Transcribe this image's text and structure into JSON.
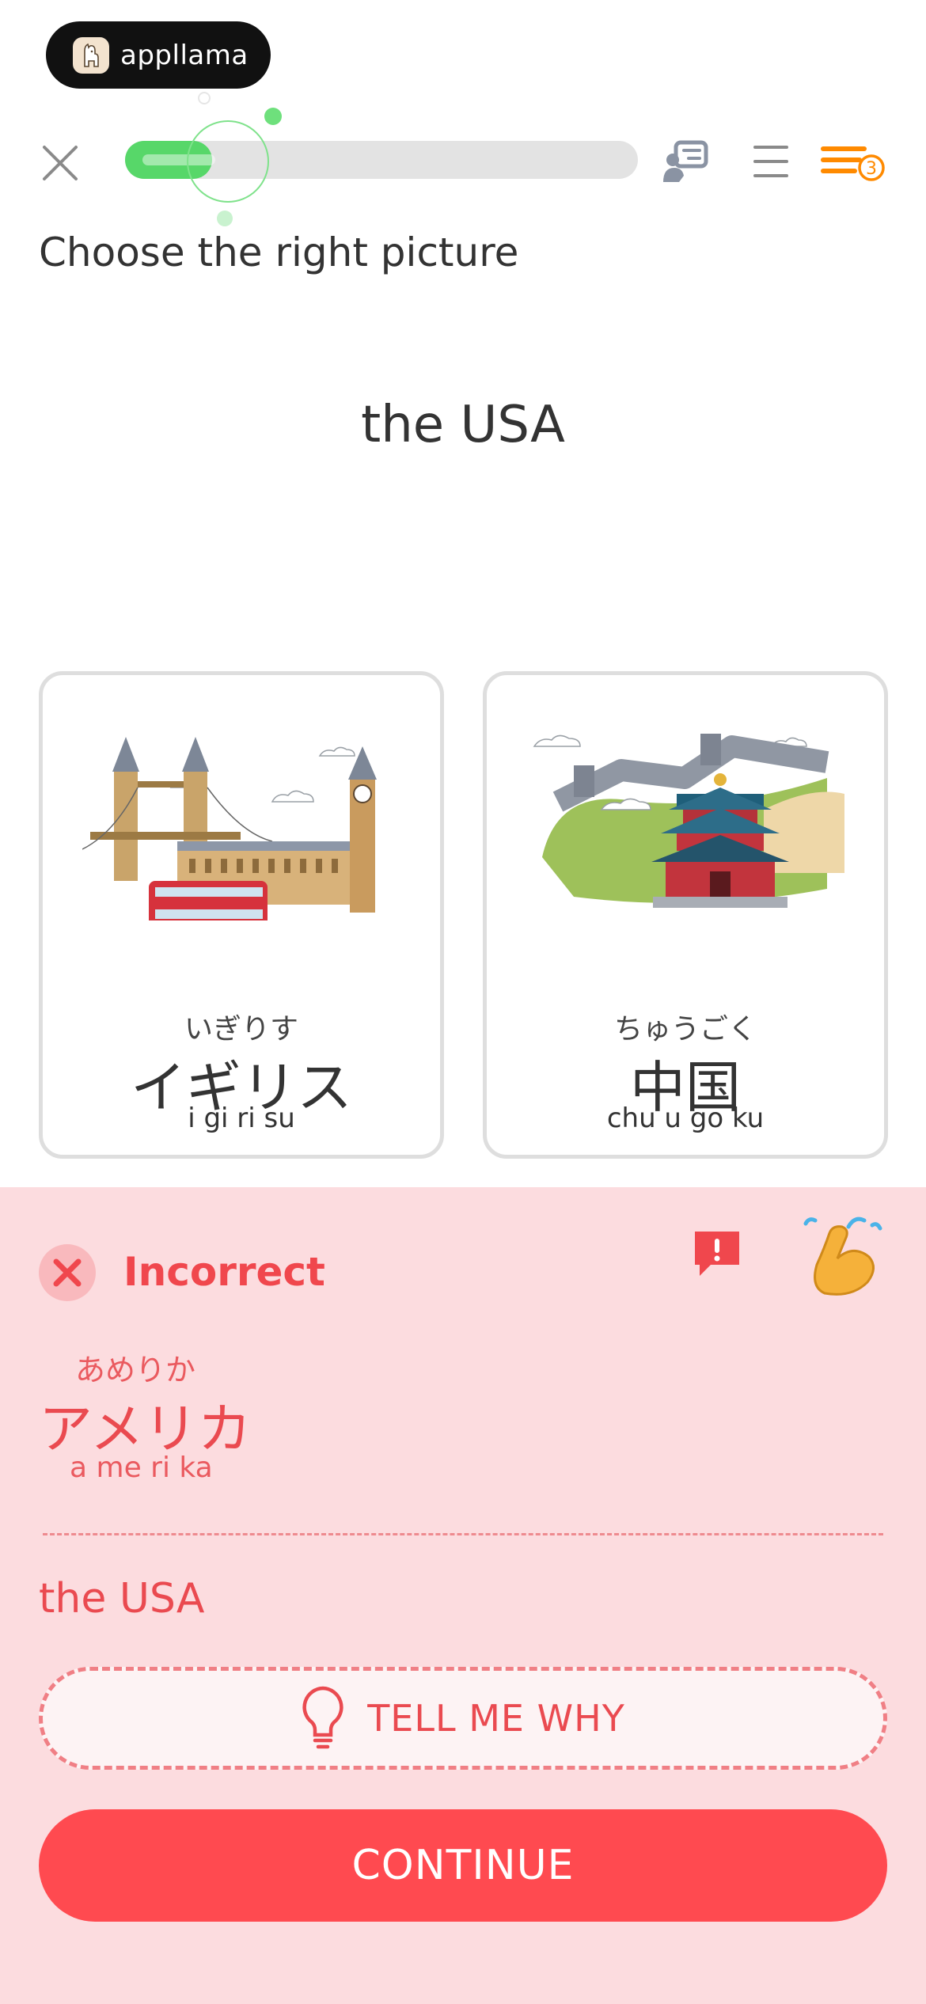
{
  "brand": {
    "name": "appllama",
    "icon": "llama-icon"
  },
  "header": {
    "progress_fraction": 0.17,
    "hearts_badge": "3",
    "colors": {
      "progress": "#57d769",
      "accent": "#ff8a00"
    }
  },
  "exercise": {
    "instruction": "Choose the right picture",
    "prompt": "the USA",
    "options": [
      {
        "illustration": "london-landmarks-illustration",
        "kana": "いぎりす",
        "word": "イギリス",
        "romaji": "i gi ri su"
      },
      {
        "illustration": "china-great-wall-temple-illustration",
        "kana": "ちゅうごく",
        "word": "中国",
        "romaji": "chu u go ku"
      }
    ]
  },
  "feedback": {
    "status": "Incorrect",
    "answer_kana": "あめりか",
    "answer_word": "アメリカ",
    "answer_romaji": "a me ri ka",
    "translation": "the USA",
    "tell_me_why_label": "TELL ME WHY",
    "continue_label": "CONTINUE",
    "colors": {
      "panel": "#fcdcdf",
      "error": "#ff4a50"
    }
  }
}
